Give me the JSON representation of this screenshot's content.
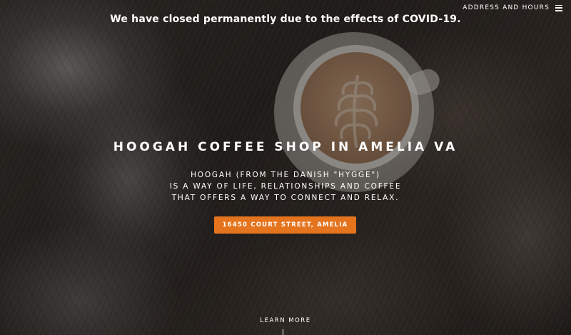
{
  "banner": {
    "text": "We have closed permanently due to the effects of COVID-19."
  },
  "nav": {
    "label": "ADDRESS AND HOURS",
    "icon": "hamburger-menu-icon"
  },
  "hero": {
    "title": "HOOGAH COFFEE SHOP IN AMELIA VA",
    "description_lines": [
      "HOOGAH (FROM THE DANISH \"HYGGE\")",
      "IS A WAY OF LIFE, RELATIONSHIPS AND COFFEE",
      "THAT OFFERS A WAY TO CONNECT AND RELAX."
    ],
    "cta_label": "16450 COURT STREET, AMELIA",
    "cta_color": "#e5741e"
  },
  "footer": {
    "learn_more": "LEARN MORE"
  }
}
